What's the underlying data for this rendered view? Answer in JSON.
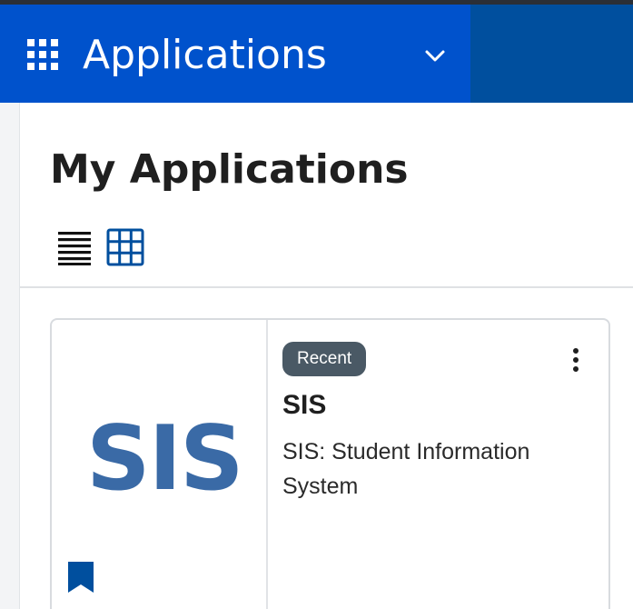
{
  "header": {
    "title": "Applications",
    "icon": "app-grid-icon",
    "dropdown_icon": "chevron-down-icon",
    "colors": {
      "switcher": "#0052cc",
      "bar": "#004f9e"
    }
  },
  "main": {
    "page_title": "My Applications",
    "view_options": [
      {
        "name": "list-view",
        "icon": "list-icon"
      },
      {
        "name": "grid-view",
        "icon": "grid-view-icon",
        "selected": true
      }
    ]
  },
  "cards": [
    {
      "logo_text": "SIS",
      "badge": "Recent",
      "title": "SIS",
      "description": "SIS: Student Information System",
      "bookmark_icon": "bookmark-icon",
      "menu_icon": "more-vertical-icon"
    }
  ]
}
